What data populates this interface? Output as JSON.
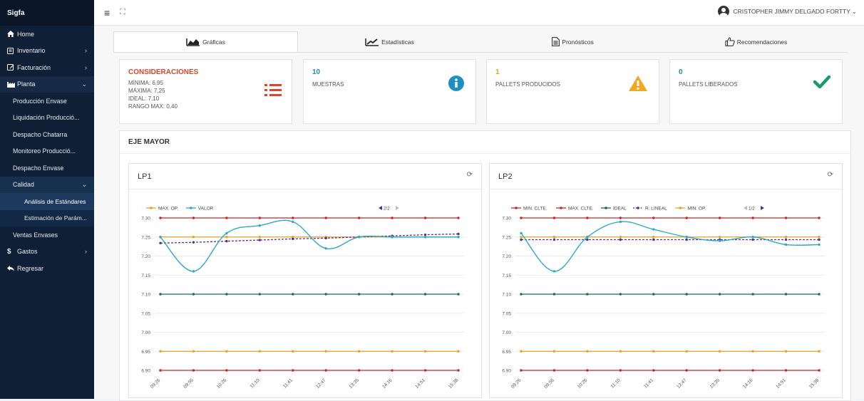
{
  "app": {
    "brand": "Sigfa"
  },
  "user": {
    "name": "CRISTOPHER JIMMY DELGADO FORTTY"
  },
  "sidebar": {
    "items": [
      {
        "label": "Home"
      },
      {
        "label": "Inventario"
      },
      {
        "label": "Facturación"
      },
      {
        "label": "Planta"
      }
    ],
    "planta_sub": [
      "Producción Envase",
      "Liquidación Producció...",
      "Despacho Chatarra",
      "Monitoreo Producció...",
      "Despacho Envase",
      "Calidad"
    ],
    "calidad_sub": [
      "Análisis de Estándares",
      "Estimación de Parám..."
    ],
    "after": [
      "Ventas Envases"
    ],
    "gastos": "Gastos",
    "regresar": "Regresar"
  },
  "tabs": [
    "Gráficas",
    "Estadísticas",
    "Pronósticos",
    "Recomendaciones"
  ],
  "cards": {
    "consideraciones": {
      "title": "CONSIDERACIONES",
      "lines": [
        "MÍNIMA: 6,95",
        "MÁXIMA: 7,25",
        "IDEAL: 7,10",
        "RANGO MAX: 0,40"
      ],
      "color": "#e0452a"
    },
    "muestras": {
      "value": "10",
      "label": "MUESTRAS",
      "color": "#1f8fc2"
    },
    "pallets_producidos": {
      "value": "1",
      "label": "PALLETS PRODUCIDOS",
      "color": "#e8a31b"
    },
    "pallets_liberados": {
      "value": "0",
      "label": "PALLETS LIBERADOS",
      "color": "#1b9a6a"
    }
  },
  "section": {
    "title": "EJE MAYOR"
  },
  "colors": {
    "min_clte": "#c0282d",
    "max_clte": "#c0282d",
    "ideal": "#1e6b53",
    "r_lineal": "#5b2d90",
    "max_op": "#e0a52a",
    "min_op": "#e0a52a",
    "valor": "#2ea9c8",
    "legend_nav": "#2a3f8f"
  },
  "chart_data": [
    {
      "type": "line",
      "title": "LP1",
      "legend": [
        "MAX. OP.",
        "VALOR"
      ],
      "legend_page": "2/2",
      "x": [
        "09:26",
        "09:55",
        "10:26",
        "11:10",
        "11:41",
        "12:47",
        "13:35",
        "14:16",
        "14:51",
        "15:38"
      ],
      "ylim": [
        6.9,
        7.3
      ],
      "yticks": [
        "7.30",
        "7.25",
        "7.20",
        "7.15",
        "7.10",
        "7.05",
        "7.00",
        "6.95",
        "6.90"
      ],
      "series": [
        {
          "name": "MIN. CLTE.",
          "values": [
            6.9,
            6.9,
            6.9,
            6.9,
            6.9,
            6.9,
            6.9,
            6.9,
            6.9,
            6.9
          ]
        },
        {
          "name": "MAX. CLTE.",
          "values": [
            7.3,
            7.3,
            7.3,
            7.3,
            7.3,
            7.3,
            7.3,
            7.3,
            7.3,
            7.3
          ]
        },
        {
          "name": "IDEAL",
          "values": [
            7.1,
            7.1,
            7.1,
            7.1,
            7.1,
            7.1,
            7.1,
            7.1,
            7.1,
            7.1
          ]
        },
        {
          "name": "R. LINEAL",
          "values": [
            7.234,
            7.236,
            7.239,
            7.242,
            7.245,
            7.247,
            7.25,
            7.253,
            7.256,
            7.258
          ]
        },
        {
          "name": "MAX. OP.",
          "values": [
            7.25,
            7.25,
            7.25,
            7.25,
            7.25,
            7.25,
            7.25,
            7.25,
            7.25,
            7.25
          ]
        },
        {
          "name": "MIN. OP.",
          "values": [
            6.95,
            6.95,
            6.95,
            6.95,
            6.95,
            6.95,
            6.95,
            6.95,
            6.95,
            6.95
          ]
        },
        {
          "name": "VALOR",
          "values": [
            7.25,
            7.16,
            7.26,
            7.28,
            7.29,
            7.22,
            7.25,
            7.25,
            7.25,
            7.25
          ]
        }
      ]
    },
    {
      "type": "line",
      "title": "LP2",
      "legend": [
        "MIN. CLTE.",
        "MAX. CLTE.",
        "IDEAL",
        "R. LINEAL",
        "MIN. OP."
      ],
      "legend_page": "1/2",
      "x": [
        "09:26",
        "09:55",
        "10:26",
        "11:10",
        "11:41",
        "12:47",
        "13:35",
        "14:16",
        "14:51",
        "15:38"
      ],
      "ylim": [
        6.9,
        7.3
      ],
      "yticks": [
        "7.30",
        "7.25",
        "7.20",
        "7.15",
        "7.10",
        "7.05",
        "7.00",
        "6.95",
        "6.90"
      ],
      "series": [
        {
          "name": "MIN. CLTE.",
          "values": [
            6.9,
            6.9,
            6.9,
            6.9,
            6.9,
            6.9,
            6.9,
            6.9,
            6.9,
            6.9
          ]
        },
        {
          "name": "MAX. CLTE.",
          "values": [
            7.3,
            7.3,
            7.3,
            7.3,
            7.3,
            7.3,
            7.3,
            7.3,
            7.3,
            7.3
          ]
        },
        {
          "name": "IDEAL",
          "values": [
            7.1,
            7.1,
            7.1,
            7.1,
            7.1,
            7.1,
            7.1,
            7.1,
            7.1,
            7.1
          ]
        },
        {
          "name": "R. LINEAL",
          "values": [
            7.243,
            7.243,
            7.243,
            7.243,
            7.243,
            7.243,
            7.243,
            7.243,
            7.243,
            7.243
          ]
        },
        {
          "name": "MAX. OP.",
          "values": [
            7.25,
            7.25,
            7.25,
            7.25,
            7.25,
            7.25,
            7.25,
            7.25,
            7.25,
            7.25
          ]
        },
        {
          "name": "MIN. OP.",
          "values": [
            6.95,
            6.95,
            6.95,
            6.95,
            6.95,
            6.95,
            6.95,
            6.95,
            6.95,
            6.95
          ]
        },
        {
          "name": "VALOR",
          "values": [
            7.26,
            7.16,
            7.25,
            7.29,
            7.27,
            7.25,
            7.24,
            7.25,
            7.23,
            7.23
          ]
        }
      ]
    }
  ]
}
